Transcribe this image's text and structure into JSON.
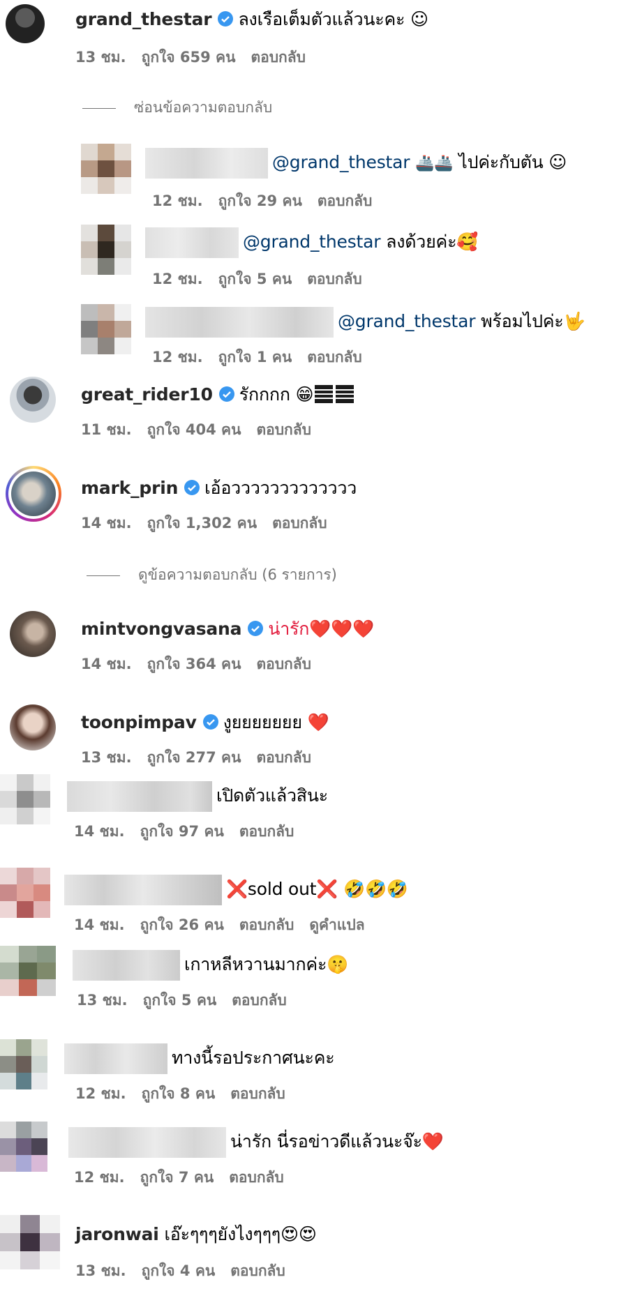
{
  "icons": {
    "verified": "verified-badge-icon"
  },
  "comments": [
    {
      "username": "grand_thestar",
      "text": "ลงเรือเต็มตัวแล้วนะคะ ☺",
      "time": "13 ชม.",
      "likes": "ถูกใจ 659 คน",
      "reply": "ตอบกลับ"
    },
    {
      "toggle": "ซ่อนข้อความตอบกลับ"
    },
    {
      "mention": "@grand_thestar",
      "text": "ไปค่ะกับตัน ☺",
      "time": "12 ชม.",
      "likes": "ถูกใจ 29 คน",
      "reply": "ตอบกลับ"
    },
    {
      "mention": "@grand_thestar",
      "text": "ลงด้วยค่ะ🥰",
      "time": "12 ชม.",
      "likes": "ถูกใจ 5 คน",
      "reply": "ตอบกลับ"
    },
    {
      "mention": "@grand_thestar",
      "text": "พร้อมไปค่ะ🤟",
      "time": "12 ชม.",
      "likes": "ถูกใจ 1 คน",
      "reply": "ตอบกลับ"
    },
    {
      "username": "great_rider10",
      "text": "รักกกก 😁",
      "time": "11 ชม.",
      "likes": "ถูกใจ 404 คน",
      "reply": "ตอบกลับ"
    },
    {
      "username": "mark_prin",
      "text": "เอ้อววววววววววววว",
      "time": "14 ชม.",
      "likes": "ถูกใจ 1,302 คน",
      "reply": "ตอบกลับ"
    },
    {
      "toggle": "ดูข้อความตอบกลับ (6 รายการ)"
    },
    {
      "username": "mintvongvasana",
      "text": "น่ารัก❤️❤️❤️",
      "time": "14 ชม.",
      "likes": "ถูกใจ 364 คน",
      "reply": "ตอบกลับ"
    },
    {
      "username": "toonpimpav",
      "text": "งูยยยยยยย ❤️",
      "time": "13 ชม.",
      "likes": "ถูกใจ 277 คน",
      "reply": "ตอบกลับ"
    },
    {
      "text": "เปิดตัวแล้วสินะ",
      "time": "14 ชม.",
      "likes": "ถูกใจ 97 คน",
      "reply": "ตอบกลับ"
    },
    {
      "text": "❌sold out❌ 🤣🤣🤣",
      "time": "14 ชม.",
      "likes": "ถูกใจ 26 คน",
      "reply": "ตอบกลับ",
      "translate": "ดูคำแปล"
    },
    {
      "text": "เกาหลีหวานมากค่ะ🤫",
      "time": "13 ชม.",
      "likes": "ถูกใจ 5 คน",
      "reply": "ตอบกลับ"
    },
    {
      "text": "ทางนี้รอประกาศนะคะ",
      "time": "12 ชม.",
      "likes": "ถูกใจ 8 คน",
      "reply": "ตอบกลับ"
    },
    {
      "text": "น่ารัก นี่รอข่าวดีแล้วนะจ๊ะ❤️",
      "time": "12 ชม.",
      "likes": "ถูกใจ 7 คน",
      "reply": "ตอบกลับ"
    },
    {
      "username": "jaronwai",
      "text": "เอ๊ะๆๆๆยังไงๆๆๆ😍😍",
      "time": "13 ชม.",
      "likes": "ถูกใจ 4 คน",
      "reply": "ตอบกลับ"
    }
  ]
}
